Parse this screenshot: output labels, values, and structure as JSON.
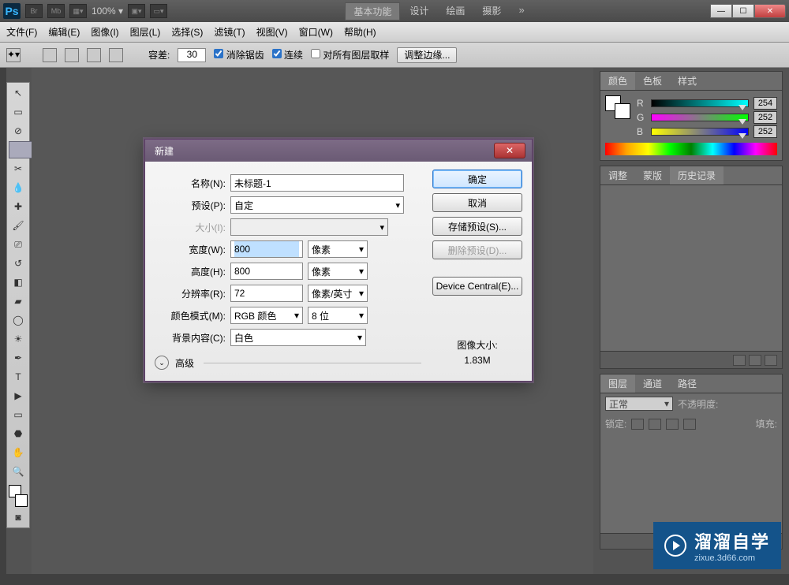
{
  "workspace": {
    "active": "基本功能",
    "items": [
      "基本功能",
      "设计",
      "绘画",
      "摄影"
    ]
  },
  "menubar": [
    "文件(F)",
    "编辑(E)",
    "图像(I)",
    "图层(L)",
    "选择(S)",
    "滤镜(T)",
    "视图(V)",
    "窗口(W)",
    "帮助(H)"
  ],
  "topbar": {
    "br": "Br",
    "mb": "Mb",
    "zoom": "100%"
  },
  "options": {
    "tolerance_label": "容差:",
    "tolerance": "30",
    "antialias": "消除锯齿",
    "contiguous": "连续",
    "all_layers": "对所有图层取样",
    "refine": "调整边缘..."
  },
  "panels": {
    "color_tabs": [
      "颜色",
      "色板",
      "样式"
    ],
    "sliders": [
      {
        "lab": "R",
        "val": "254"
      },
      {
        "lab": "G",
        "val": "252"
      },
      {
        "lab": "B",
        "val": "252"
      }
    ],
    "adjust_tabs": [
      "调整",
      "蒙版",
      "历史记录"
    ],
    "layer_tabs": [
      "图层",
      "通道",
      "路径"
    ],
    "layer_row": {
      "blend": "正常",
      "opacity_label": "不透明度:",
      "lock_label": "锁定:",
      "fill_label": "填充:"
    }
  },
  "dialog": {
    "title": "新建",
    "labels": {
      "name": "名称(N):",
      "preset": "预设(P):",
      "size": "大小(I):",
      "width": "宽度(W):",
      "height": "高度(H):",
      "res": "分辨率(R):",
      "mode": "颜色模式(M):",
      "bg": "背景内容(C):",
      "advanced": "高级"
    },
    "values": {
      "name": "未标题-1",
      "preset": "自定",
      "size": "",
      "width": "800",
      "height": "800",
      "res": "72",
      "mode": "RGB 颜色",
      "depth": "8 位",
      "bg": "白色"
    },
    "units": {
      "width": "像素",
      "height": "像素",
      "res": "像素/英寸"
    },
    "buttons": {
      "ok": "确定",
      "cancel": "取消",
      "save": "存储预设(S)...",
      "delete": "删除预设(D)...",
      "device": "Device Central(E)..."
    },
    "filesize_label": "图像大小:",
    "filesize": "1.83M"
  },
  "watermark": {
    "big": "溜溜自学",
    "sm": "zixue.3d66.com"
  }
}
